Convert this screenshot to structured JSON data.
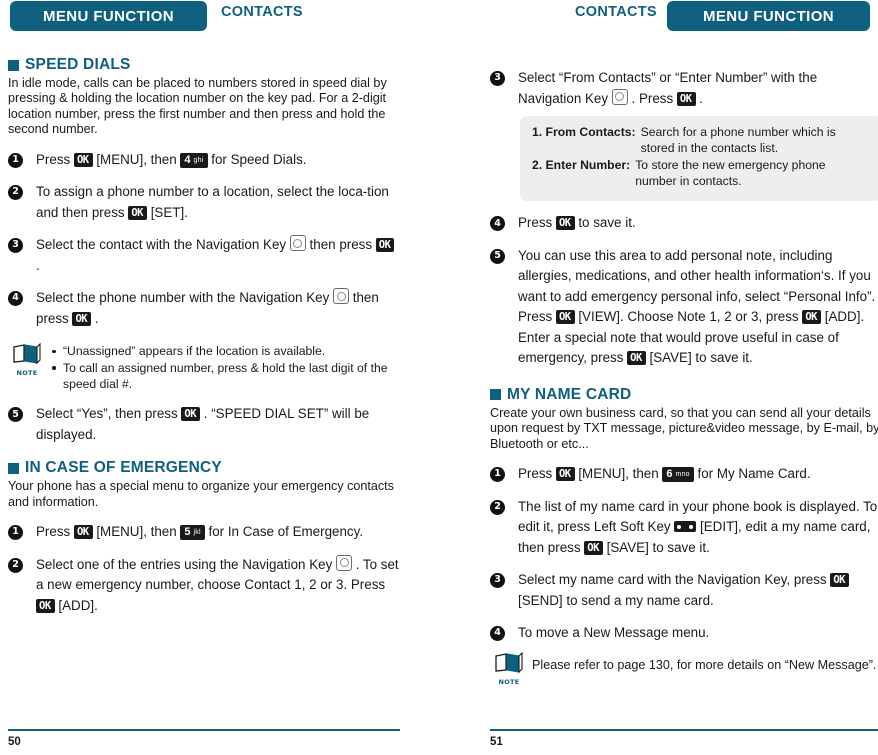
{
  "header": {
    "left_tab": "MENU FUNCTION",
    "left_crumb": "CONTACTS",
    "right_crumb": "CONTACTS",
    "right_tab": "MENU FUNCTION",
    "accent_color": "#0f5f7f"
  },
  "left_page": {
    "page_number": "50",
    "sections": [
      {
        "title": "SPEED DIALS",
        "description": "In idle mode, calls can be placed to numbers stored in speed dial by pressing & holding the location number on the key pad. For a 2-digit location number, press the first number and then press and hold the second number.",
        "steps": [
          {
            "num": "1",
            "parts": [
              {
                "t": "text",
                "v": "Press "
              },
              {
                "t": "key-ok",
                "v": "OK"
              },
              {
                "t": "text",
                "v": " [MENU], then "
              },
              {
                "t": "key-num",
                "v": "4",
                "sub": "ghi"
              },
              {
                "t": "text",
                "v": " for Speed Dials."
              }
            ]
          },
          {
            "num": "2",
            "parts": [
              {
                "t": "text",
                "v": "To assign a phone number to a location, select the loca-tion and then press "
              },
              {
                "t": "key-ok",
                "v": "OK"
              },
              {
                "t": "text",
                "v": " [SET]."
              }
            ]
          },
          {
            "num": "3",
            "parts": [
              {
                "t": "text",
                "v": "Select the contact with the Navigation Key "
              },
              {
                "t": "key-nav",
                "v": "nav"
              },
              {
                "t": "text",
                "v": " then press "
              },
              {
                "t": "key-ok",
                "v": "OK"
              },
              {
                "t": "text",
                "v": " ."
              }
            ]
          },
          {
            "num": "4",
            "parts": [
              {
                "t": "text",
                "v": "Select the phone number with the Navigation Key "
              },
              {
                "t": "key-nav",
                "v": "nav"
              },
              {
                "t": "text",
                "v": " then press "
              },
              {
                "t": "key-ok",
                "v": "OK"
              },
              {
                "t": "text",
                "v": " ."
              }
            ]
          }
        ]
      }
    ],
    "note": {
      "label": "NOTE",
      "items": [
        "“Unassigned” appears if the location is available.",
        "To call an assigned number, press & hold the last digit of the speed dial #."
      ]
    },
    "step5": {
      "num": "5",
      "parts": [
        {
          "t": "text",
          "v": "Select “Yes”, then press "
        },
        {
          "t": "key-ok",
          "v": "OK"
        },
        {
          "t": "text",
          "v": " . “SPEED DIAL SET” will be displayed."
        }
      ]
    },
    "section2": {
      "title": "IN CASE OF EMERGENCY",
      "description": "Your phone has a special menu to organize your emergency contacts and information.",
      "steps": [
        {
          "num": "1",
          "parts": [
            {
              "t": "text",
              "v": "Press "
            },
            {
              "t": "key-ok",
              "v": "OK"
            },
            {
              "t": "text",
              "v": " [MENU], then "
            },
            {
              "t": "key-num",
              "v": "5",
              "sub": "jkl"
            },
            {
              "t": "text",
              "v": " for In Case of Emergency."
            }
          ]
        },
        {
          "num": "2",
          "parts": [
            {
              "t": "text",
              "v": "Select one of the entries using the Navigation Key "
            },
            {
              "t": "key-nav",
              "v": "nav"
            },
            {
              "t": "text",
              "v": " . To set a new emergency number, choose Contact 1, 2 or 3. Press "
            },
            {
              "t": "key-ok",
              "v": "OK"
            },
            {
              "t": "text",
              "v": " [ADD]."
            }
          ]
        }
      ]
    }
  },
  "right_page": {
    "page_number": "51",
    "step3": {
      "num": "3",
      "parts": [
        {
          "t": "text",
          "v": "Select “From Contacts” or “Enter Number” with the Navigation Key "
        },
        {
          "t": "key-nav",
          "v": "nav"
        },
        {
          "t": "text",
          "v": " . Press "
        },
        {
          "t": "key-ok",
          "v": "OK"
        },
        {
          "t": "text",
          "v": " ."
        }
      ]
    },
    "infobox": [
      {
        "label": "1. From Contacts:",
        "text": "Search for a phone number which is stored in the contacts list."
      },
      {
        "label": "2. Enter Number:",
        "text": "To store the new emergency phone number in contacts."
      }
    ],
    "steps": [
      {
        "num": "4",
        "parts": [
          {
            "t": "text",
            "v": "Press "
          },
          {
            "t": "key-ok",
            "v": "OK"
          },
          {
            "t": "text",
            "v": " to save it."
          }
        ]
      },
      {
        "num": "5",
        "parts": [
          {
            "t": "text",
            "v": "You can use this area to add personal note, including allergies, medications, and other health information‘s. If you want to add emergency personal info, select “Personal Info”. Press "
          },
          {
            "t": "key-ok",
            "v": "OK"
          },
          {
            "t": "text",
            "v": " [VIEW]. Choose Note 1, 2 or 3, press "
          },
          {
            "t": "key-ok",
            "v": "OK"
          },
          {
            "t": "text",
            "v": " [ADD]. Enter a special note that would prove useful in case of emergency, press "
          },
          {
            "t": "key-ok",
            "v": "OK"
          },
          {
            "t": "text",
            "v": " [SAVE] to save it."
          }
        ]
      }
    ],
    "section2": {
      "title": "MY NAME CARD",
      "description": "Create your own business card, so that you can send all your details upon request by TXT message, picture&video message, by E-mail, by Bluetooth or etc...",
      "steps": [
        {
          "num": "1",
          "parts": [
            {
              "t": "text",
              "v": "Press "
            },
            {
              "t": "key-ok",
              "v": "OK"
            },
            {
              "t": "text",
              "v": " [MENU], then "
            },
            {
              "t": "key-num",
              "v": "6",
              "sub": "mno"
            },
            {
              "t": "text",
              "v": " for My Name Card."
            }
          ]
        },
        {
          "num": "2",
          "parts": [
            {
              "t": "text",
              "v": "The list of my name card in your phone book is displayed. To edit it, press Left Soft Key "
            },
            {
              "t": "key-soft",
              "v": "soft"
            },
            {
              "t": "text",
              "v": " [EDIT], edit a my name card, then press "
            },
            {
              "t": "key-ok",
              "v": "OK"
            },
            {
              "t": "text",
              "v": " [SAVE] to save it."
            }
          ]
        },
        {
          "num": "3",
          "parts": [
            {
              "t": "text",
              "v": "Select my name card with the Navigation Key, press "
            },
            {
              "t": "key-ok",
              "v": "OK"
            },
            {
              "t": "text",
              "v": " [SEND] to send a my name card."
            }
          ]
        },
        {
          "num": "4",
          "parts": [
            {
              "t": "text",
              "v": "To move a New Message menu."
            }
          ]
        }
      ]
    },
    "note": {
      "label": "NOTE",
      "text": "Please refer to page 130, for more details on “New Message”."
    }
  }
}
